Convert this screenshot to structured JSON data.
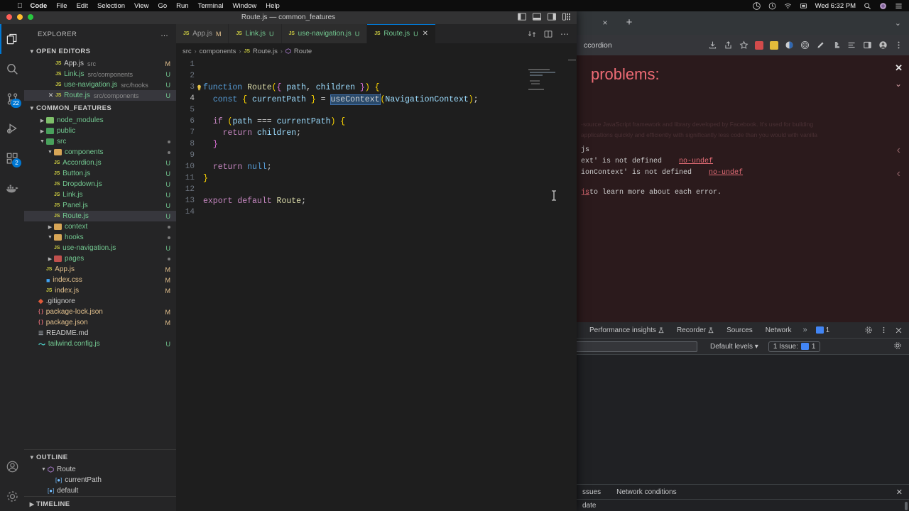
{
  "menubar": {
    "apple_icon": "apple-icon",
    "items": [
      {
        "label": "Code",
        "bold": true
      },
      {
        "label": "File",
        "bold": false
      },
      {
        "label": "Edit",
        "bold": false
      },
      {
        "label": "Selection",
        "bold": false
      },
      {
        "label": "View",
        "bold": false
      },
      {
        "label": "Go",
        "bold": false
      },
      {
        "label": "Run",
        "bold": false
      },
      {
        "label": "Terminal",
        "bold": false
      },
      {
        "label": "Window",
        "bold": false
      },
      {
        "label": "Help",
        "bold": false
      }
    ],
    "status_icons": [
      "dropbox-icon",
      "time-machine-icon",
      "wifi-icon",
      "display-icon"
    ],
    "clock": "Wed 6:32 PM",
    "right_icons": [
      "search-icon",
      "siri-icon",
      "control-center-icon"
    ]
  },
  "vscode": {
    "title": "Route.js — common_features",
    "traffic_lights": {
      "close": "#ff5f57",
      "minimize": "#febc2e",
      "maximize": "#28c840"
    },
    "layout_icons": [
      "toggle-primary-sidebar-icon",
      "toggle-panel-icon",
      "toggle-secondary-sidebar-icon",
      "customize-layout-icon"
    ],
    "activity_bar": [
      {
        "name": "explorer",
        "icon": "files-icon",
        "active": true,
        "badge": null
      },
      {
        "name": "search",
        "icon": "search-icon",
        "active": false,
        "badge": null
      },
      {
        "name": "source-control",
        "icon": "source-control-icon",
        "active": false,
        "badge": "22"
      },
      {
        "name": "run-and-debug",
        "icon": "run-debug-icon",
        "active": false,
        "badge": null
      },
      {
        "name": "extensions",
        "icon": "extensions-icon",
        "active": false,
        "badge": "2"
      },
      {
        "name": "docker",
        "icon": "docker-icon",
        "active": false,
        "badge": null
      }
    ],
    "activity_bar_bottom": [
      {
        "name": "accounts",
        "icon": "account-icon"
      },
      {
        "name": "settings",
        "icon": "gear-icon"
      }
    ],
    "sidebar": {
      "header": "EXPLORER",
      "more_actions": "…",
      "open_editors": {
        "label": "OPEN EDITORS",
        "items": [
          {
            "name": "App.js",
            "path": "src",
            "status": "M",
            "status_color": "#e2c08d",
            "selected": false,
            "close": false
          },
          {
            "name": "Link.js",
            "path": "src/components",
            "status": "U",
            "status_color": "#73c991",
            "selected": false,
            "close": false
          },
          {
            "name": "use-navigation.js",
            "path": "src/hooks",
            "status": "U",
            "status_color": "#73c991",
            "selected": false,
            "close": false
          },
          {
            "name": "Route.js",
            "path": "src/components",
            "status": "U",
            "status_color": "#73c991",
            "selected": true,
            "close": true
          }
        ]
      },
      "project": {
        "label": "COMMON_FEATURES",
        "items": [
          {
            "name": "node_modules",
            "type": "folder",
            "indent": 1,
            "expanded": false,
            "color": "#73c991",
            "status": "",
            "dot": false,
            "folder_color": "#7ec06a"
          },
          {
            "name": "public",
            "type": "folder",
            "indent": 1,
            "expanded": false,
            "color": "#73c991",
            "status": "",
            "dot": false,
            "folder_color": "#49a15c"
          },
          {
            "name": "src",
            "type": "folder",
            "indent": 1,
            "expanded": true,
            "color": "#73c991",
            "status": "",
            "dot": true,
            "folder_color": "#49a15c"
          },
          {
            "name": "components",
            "type": "folder",
            "indent": 2,
            "expanded": true,
            "color": "#73c991",
            "status": "",
            "dot": true,
            "folder_color": "#d8a657"
          },
          {
            "name": "Accordion.js",
            "type": "js",
            "indent": 3,
            "expanded": null,
            "color": "#73c991",
            "status": "U",
            "dot": false
          },
          {
            "name": "Button.js",
            "type": "js",
            "indent": 3,
            "expanded": null,
            "color": "#73c991",
            "status": "U",
            "dot": false
          },
          {
            "name": "Dropdown.js",
            "type": "js",
            "indent": 3,
            "expanded": null,
            "color": "#73c991",
            "status": "U",
            "dot": false
          },
          {
            "name": "Link.js",
            "type": "js",
            "indent": 3,
            "expanded": null,
            "color": "#73c991",
            "status": "U",
            "dot": false
          },
          {
            "name": "Panel.js",
            "type": "js",
            "indent": 3,
            "expanded": null,
            "color": "#73c991",
            "status": "U",
            "dot": false
          },
          {
            "name": "Route.js",
            "type": "js",
            "indent": 3,
            "expanded": null,
            "color": "#73c991",
            "status": "U",
            "dot": false,
            "selected": true
          },
          {
            "name": "context",
            "type": "folder",
            "indent": 2,
            "expanded": false,
            "color": "#73c991",
            "status": "",
            "dot": true,
            "folder_color": "#d8a657"
          },
          {
            "name": "hooks",
            "type": "folder",
            "indent": 2,
            "expanded": true,
            "color": "#73c991",
            "status": "",
            "dot": true,
            "folder_color": "#d8a657"
          },
          {
            "name": "use-navigation.js",
            "type": "js",
            "indent": 3,
            "expanded": null,
            "color": "#73c991",
            "status": "U",
            "dot": false
          },
          {
            "name": "pages",
            "type": "folder",
            "indent": 2,
            "expanded": false,
            "color": "#73c991",
            "status": "",
            "dot": true,
            "folder_color": "#c0504d"
          },
          {
            "name": "App.js",
            "type": "js",
            "indent": 2,
            "expanded": null,
            "color": "#e2c08d",
            "status": "M",
            "dot": false
          },
          {
            "name": "index.css",
            "type": "css",
            "indent": 2,
            "expanded": null,
            "color": "#e2c08d",
            "status": "M",
            "dot": false
          },
          {
            "name": "index.js",
            "type": "js",
            "indent": 2,
            "expanded": null,
            "color": "#e2c08d",
            "status": "M",
            "dot": false
          },
          {
            "name": ".gitignore",
            "type": "git",
            "indent": 1,
            "expanded": null,
            "color": "#cccccc",
            "status": "",
            "dot": false
          },
          {
            "name": "package-lock.json",
            "type": "json",
            "indent": 1,
            "expanded": null,
            "color": "#e2c08d",
            "status": "M",
            "dot": false
          },
          {
            "name": "package.json",
            "type": "json",
            "indent": 1,
            "expanded": null,
            "color": "#e2c08d",
            "status": "M",
            "dot": false
          },
          {
            "name": "README.md",
            "type": "md",
            "indent": 1,
            "expanded": null,
            "color": "#cccccc",
            "status": "",
            "dot": false
          },
          {
            "name": "tailwind.config.js",
            "type": "tw",
            "indent": 1,
            "expanded": null,
            "color": "#73c991",
            "status": "U",
            "dot": false
          }
        ]
      },
      "outline": {
        "label": "OUTLINE",
        "items": [
          {
            "name": "Route",
            "kind": "function",
            "indent": 1,
            "expanded": true
          },
          {
            "name": "currentPath",
            "kind": "variable",
            "indent": 2,
            "expanded": null
          },
          {
            "name": "default",
            "kind": "variable",
            "indent": 1,
            "expanded": null
          }
        ]
      },
      "timeline": {
        "label": "TIMELINE"
      }
    },
    "tabs": [
      {
        "name": "App.js",
        "status": "M",
        "status_color": "#e2c08d",
        "active": false,
        "close": false
      },
      {
        "name": "Link.js",
        "status": "U",
        "status_color": "#73c991",
        "active": false,
        "close": false
      },
      {
        "name": "use-navigation.js",
        "status": "U",
        "status_color": "#73c991",
        "active": false,
        "close": false
      },
      {
        "name": "Route.js",
        "status": "U",
        "status_color": "#73c991",
        "active": true,
        "close": true
      }
    ],
    "tab_actions": [
      "split-editor-icon",
      "open-changes-icon",
      "more-actions-icon"
    ],
    "breadcrumb": [
      "src",
      "components",
      "Route.js",
      "Route"
    ],
    "code_lines": [
      {
        "n": 1,
        "segments": []
      },
      {
        "n": 2,
        "segments": []
      },
      {
        "n": 3,
        "segments": [
          {
            "t": "function",
            "c": "kw2"
          },
          {
            "t": " ",
            "c": "pu"
          },
          {
            "t": "Route",
            "c": "fn"
          },
          {
            "t": "(",
            "c": "br1"
          },
          {
            "t": "{ ",
            "c": "br2"
          },
          {
            "t": "path",
            "c": "pm"
          },
          {
            "t": ", ",
            "c": "pu"
          },
          {
            "t": "children",
            "c": "pm"
          },
          {
            "t": " }",
            "c": "br2"
          },
          {
            "t": ")",
            "c": "br1"
          },
          {
            "t": " ",
            "c": "pu"
          },
          {
            "t": "{",
            "c": "br1"
          }
        ]
      },
      {
        "n": 4,
        "segments": [
          {
            "t": "  ",
            "c": "pu"
          },
          {
            "t": "const",
            "c": "kw2"
          },
          {
            "t": " ",
            "c": "pu"
          },
          {
            "t": "{ ",
            "c": "br1"
          },
          {
            "t": "currentPath",
            "c": "var"
          },
          {
            "t": " }",
            "c": "br1"
          },
          {
            "t": " = ",
            "c": "pu"
          },
          {
            "t": "useContext",
            "c": "sel-word"
          },
          {
            "t": "(",
            "c": "br1"
          },
          {
            "t": "NavigationContext",
            "c": "var"
          },
          {
            "t": ")",
            "c": "br1"
          },
          {
            "t": ";",
            "c": "pu"
          }
        ]
      },
      {
        "n": 5,
        "segments": []
      },
      {
        "n": 6,
        "segments": [
          {
            "t": "  ",
            "c": "pu"
          },
          {
            "t": "if",
            "c": "kw"
          },
          {
            "t": " ",
            "c": "pu"
          },
          {
            "t": "(",
            "c": "br1"
          },
          {
            "t": "path",
            "c": "pm"
          },
          {
            "t": " === ",
            "c": "pu"
          },
          {
            "t": "currentPath",
            "c": "var"
          },
          {
            "t": ")",
            "c": "br1"
          },
          {
            "t": " ",
            "c": "pu"
          },
          {
            "t": "{",
            "c": "br1"
          }
        ]
      },
      {
        "n": 7,
        "segments": [
          {
            "t": "    ",
            "c": "pu"
          },
          {
            "t": "return",
            "c": "kw"
          },
          {
            "t": " ",
            "c": "pu"
          },
          {
            "t": "children",
            "c": "pm"
          },
          {
            "t": ";",
            "c": "pu"
          }
        ]
      },
      {
        "n": 8,
        "segments": [
          {
            "t": "  ",
            "c": "pu"
          },
          {
            "t": "}",
            "c": "br2"
          }
        ]
      },
      {
        "n": 9,
        "segments": []
      },
      {
        "n": 10,
        "segments": [
          {
            "t": "  ",
            "c": "pu"
          },
          {
            "t": "return",
            "c": "kw"
          },
          {
            "t": " ",
            "c": "pu"
          },
          {
            "t": "null",
            "c": "kw2"
          },
          {
            "t": ";",
            "c": "pu"
          }
        ]
      },
      {
        "n": 11,
        "segments": [
          {
            "t": "}",
            "c": "br1"
          }
        ]
      },
      {
        "n": 12,
        "segments": []
      },
      {
        "n": 13,
        "segments": [
          {
            "t": "export",
            "c": "kw"
          },
          {
            "t": " ",
            "c": "pu"
          },
          {
            "t": "default",
            "c": "kw"
          },
          {
            "t": " ",
            "c": "pu"
          },
          {
            "t": "Route",
            "c": "fn"
          },
          {
            "t": ";",
            "c": "pu"
          }
        ]
      },
      {
        "n": 14,
        "segments": []
      }
    ],
    "current_line": 4
  },
  "chrome": {
    "tab_close": "×",
    "new_tab": "+",
    "tab_list_chevron": "⌄",
    "url_text": "ccordion",
    "toolbar_icons": [
      "download-icon",
      "share-icon",
      "bookmark-star-icon"
    ],
    "extension_icons": [
      "extension-red-icon",
      "extension-yellow-icon",
      "extension-blue-icon",
      "extension-target-icon",
      "extension-pen-icon",
      "puzzle-icon",
      "reading-list-icon",
      "side-panel-icon",
      "profile-icon",
      "kebab-menu-icon"
    ],
    "error_overlay": {
      "close": "✕",
      "collapse_chevron": "⌄",
      "title": "problems:",
      "background_text_line1": "-source JavaScript framework and library developed by Facebook. It's used for building",
      "background_text_line2": "applications quickly and efficiently with significantly less code than you would with vanilla",
      "lines": [
        {
          "text": "js",
          "rule": ""
        },
        {
          "text": "ext' is not defined",
          "rule": "no-undef"
        },
        {
          "text": "ionContext' is not defined",
          "rule": "no-undef"
        }
      ],
      "footer_link": "js",
      "footer_text": " to learn more about each error.",
      "nav_arrows": [
        "prev-error-arrow",
        "next-error-arrow"
      ]
    },
    "devtools": {
      "tabs": [
        "Performance insights",
        "Recorder",
        "Sources",
        "Network"
      ],
      "overflow": "»",
      "issues_count": "1",
      "toolbar_icons": [
        "settings-gear-icon",
        "kebab-menu-icon",
        "close-icon"
      ],
      "filter_placeholder": "",
      "levels_label": "Default levels",
      "issues_label": "1 Issue:",
      "issues_badge": "1",
      "filter_gear": "settings-gear-icon",
      "drawer_tabs": [
        "ssues",
        "Network conditions"
      ],
      "drawer_close": "✕",
      "drawer_content": "date"
    }
  }
}
